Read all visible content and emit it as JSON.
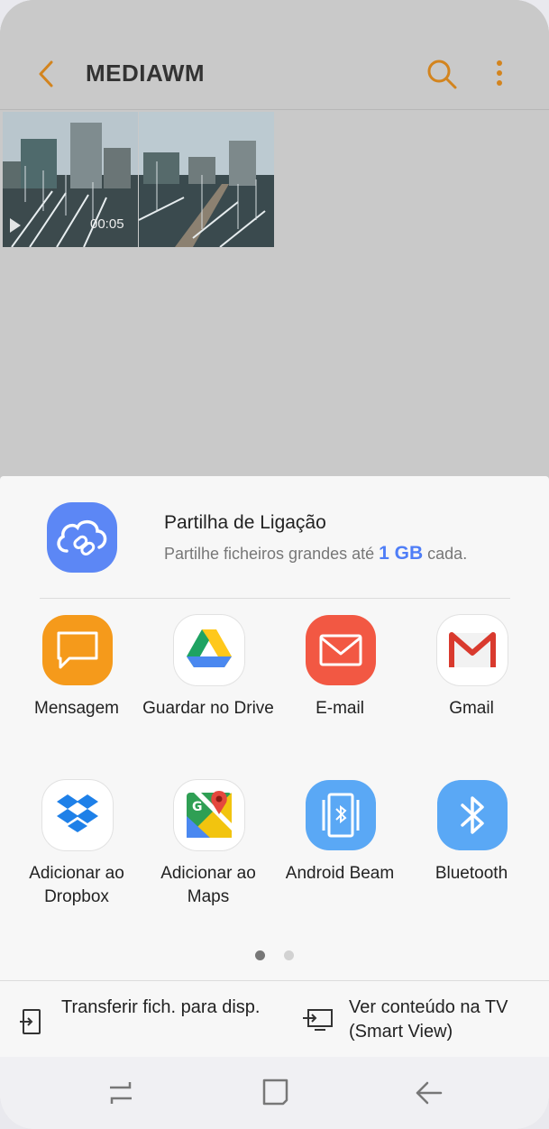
{
  "header": {
    "title": "MEDIAWM",
    "back_icon": "chevron-left-icon",
    "search_icon": "search-icon",
    "more_icon": "more-vert-icon",
    "accent_color": "#d3841e"
  },
  "gallery": {
    "items": [
      {
        "type": "video",
        "duration": "00:05"
      },
      {
        "type": "image"
      }
    ]
  },
  "share_sheet": {
    "link_share": {
      "title": "Partilha de Ligação",
      "subtitle_before": "Partilhe ficheiros grandes até ",
      "subtitle_size": "1 GB",
      "subtitle_after": " cada.",
      "icon": "cloud-link-icon"
    },
    "apps": [
      {
        "label": "Mensagem",
        "icon": "message-icon",
        "color": "#f59a1b"
      },
      {
        "label": "Guardar no Drive",
        "icon": "drive-icon",
        "color": "#ffffff"
      },
      {
        "label": "E-mail",
        "icon": "email-icon",
        "color": "#f25843"
      },
      {
        "label": "Gmail",
        "icon": "gmail-icon",
        "color": "#ffffff"
      },
      {
        "label": "Adicionar ao Dropbox",
        "icon": "dropbox-icon",
        "color": "#ffffff"
      },
      {
        "label": "Adicionar ao Maps",
        "icon": "maps-icon",
        "color": "#ffffff"
      },
      {
        "label": "Android Beam",
        "icon": "android-beam-icon",
        "color": "#5aa8f5"
      },
      {
        "label": "Bluetooth",
        "icon": "bluetooth-icon",
        "color": "#5aa8f5"
      }
    ],
    "page_indicator": {
      "current": 1,
      "total": 2
    },
    "actions": [
      {
        "label": "Transferir fich. para disp.",
        "icon": "transfer-icon"
      },
      {
        "label": "Ver conteúdo na TV (Smart View)",
        "icon": "smart-view-icon"
      }
    ]
  },
  "navbar": {
    "recents_icon": "recents-icon",
    "home_icon": "home-icon",
    "back_icon": "back-arrow-icon"
  }
}
